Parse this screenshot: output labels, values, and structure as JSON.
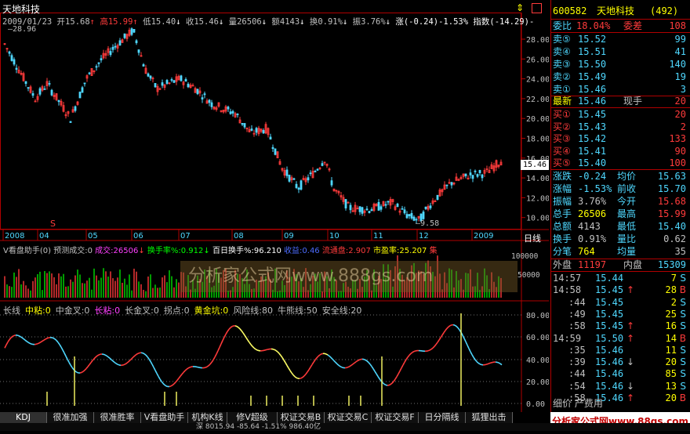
{
  "header": {
    "stock_name": "天地科技",
    "date": "2009/01/23",
    "open_label": "开",
    "open": "15.68",
    "high_label": "高",
    "high": "15.99",
    "low_label": "低",
    "low": "15.40",
    "close_label": "收",
    "close": "15.46",
    "volume_label": "量",
    "volume": "26506",
    "amount_label": "额",
    "amount": "4143",
    "turnover_label": "换",
    "turnover": "0.91%",
    "amplitude_label": "振",
    "amplitude": "3.76%",
    "change_label": "涨",
    "change": "(-0.24)-1.53%",
    "index_label": "指数",
    "index_change": "(-14.29)-",
    "high_marker": "28.96",
    "low_marker": "9.58",
    "price_tag": "15.46",
    "s_marker": "S"
  },
  "price_axis": [
    "28.00",
    "26.00",
    "24.00",
    "22.00",
    "20.00",
    "18.00",
    "16.00",
    "14.00",
    "12.00",
    "10.00"
  ],
  "month_axis": [
    "2008",
    "04",
    "05",
    "06",
    "07",
    "08",
    "09",
    "10",
    "11",
    "12",
    "2009"
  ],
  "period_label": "日线",
  "volume_panel": {
    "title": "V看盘助手(0)",
    "predict_label": "预测成交:0",
    "vol_label": "成交:26506",
    "turnover_label": "换手率%:0.912",
    "hundred_label": "百日换手%:96.210",
    "profit_label": "收益:0.46",
    "float_label": "流通盘:2.907",
    "pe_label": "市盈率:25.207",
    "tail_label": "集",
    "axis_top": "100000",
    "axis_mid": "50000",
    "watermark": "分析家公式网www.888gs.com"
  },
  "indicator_panel": {
    "items": [
      {
        "text": "长线",
        "color": "#c0c0c0"
      },
      {
        "text": "中粘:0",
        "color": "#ffff00"
      },
      {
        "text": "中金叉:0",
        "color": "#c0c0c0"
      },
      {
        "text": "长粘:0",
        "color": "#ff40ff"
      },
      {
        "text": "长金叉:0",
        "color": "#c0c0c0"
      },
      {
        "text": "拐点:0",
        "color": "#c0c0c0"
      },
      {
        "text": "黄金坑:0",
        "color": "#ffff00"
      },
      {
        "text": "风险线:80",
        "color": "#c0c0c0"
      },
      {
        "text": "牛熊线:50",
        "color": "#c0c0c0"
      },
      {
        "text": "安全线:20",
        "color": "#c0c0c0"
      }
    ],
    "axis": [
      "80.00",
      "60.00",
      "40.00",
      "20.00",
      "0.00"
    ]
  },
  "tabs": [
    "KDJ",
    "很准加强",
    "很准胜率",
    "V看盘助手",
    "机构K线",
    "修V超级MACD",
    "权证交易B",
    "权证交易C",
    "权证交易F",
    "日分隔线",
    "狐狸出击"
  ],
  "quote": {
    "code": "600582",
    "name": "天地科技",
    "count": "(492)",
    "weibi_label": "委比",
    "weibi": "18.04%",
    "weicha_label": "委差",
    "weicha": "108",
    "sells": [
      {
        "label": "卖⑤",
        "price": "15.52",
        "vol": "99"
      },
      {
        "label": "卖④",
        "price": "15.51",
        "vol": "41"
      },
      {
        "label": "卖③",
        "price": "15.50",
        "vol": "140"
      },
      {
        "label": "卖②",
        "price": "15.49",
        "vol": "19"
      },
      {
        "label": "卖①",
        "price": "15.46",
        "vol": "3"
      }
    ],
    "last_label": "最新",
    "last": "15.46",
    "now_label": "现手",
    "now_vol": "20",
    "buys": [
      {
        "label": "买①",
        "price": "15.45",
        "vol": "20"
      },
      {
        "label": "买②",
        "price": "15.43",
        "vol": "2"
      },
      {
        "label": "买③",
        "price": "15.42",
        "vol": "133"
      },
      {
        "label": "买④",
        "price": "15.41",
        "vol": "90"
      },
      {
        "label": "买⑤",
        "price": "15.40",
        "vol": "100"
      }
    ],
    "stats": [
      {
        "l1": "涨跌",
        "v1": "-0.24",
        "l2": "均价",
        "v2": "15.63"
      },
      {
        "l1": "涨幅",
        "v1": "-1.53%",
        "l2": "前收",
        "v2": "15.70"
      },
      {
        "l1": "振幅",
        "v1": "3.76%",
        "l2": "今开",
        "v2": "15.68"
      },
      {
        "l1": "总手",
        "v1": "26506",
        "l2": "最高",
        "v2": "15.99"
      },
      {
        "l1": "总额",
        "v1": "4143",
        "l2": "最低",
        "v2": "15.40"
      },
      {
        "l1": "换手",
        "v1": "0.91%",
        "l2": "量比",
        "v2": "0.62"
      },
      {
        "l1": "分笔",
        "v1": "764",
        "l2": "均量",
        "v2": "35"
      }
    ],
    "outer_label": "外盘",
    "outer": "11197",
    "inner_label": "内盘",
    "inner": "15309",
    "ticks": [
      {
        "time": "14:57",
        "price": "15.44",
        "arrow": "",
        "vol": "7",
        "side": "S"
      },
      {
        "time": "14:58",
        "price": "15.45",
        "arrow": "↑",
        "vol": "28",
        "side": "B"
      },
      {
        "time": ":44",
        "price": "15.45",
        "arrow": "",
        "vol": "2",
        "side": "S"
      },
      {
        "time": ":49",
        "price": "15.45",
        "arrow": "",
        "vol": "25",
        "side": "S"
      },
      {
        "time": ":58",
        "price": "15.45",
        "arrow": "↑",
        "vol": "16",
        "side": "S"
      },
      {
        "time": "14:59",
        "price": "15.50",
        "arrow": "↑",
        "vol": "14",
        "side": "B"
      },
      {
        "time": ":35",
        "price": "15.46",
        "arrow": "",
        "vol": "11",
        "side": "S"
      },
      {
        "time": ":39",
        "price": "15.46",
        "arrow": "↓",
        "vol": "20",
        "side": "S"
      },
      {
        "time": ":44",
        "price": "15.46",
        "arrow": "",
        "vol": "85",
        "side": "S"
      },
      {
        "time": ":54",
        "price": "15.46",
        "arrow": "↓",
        "vol": "13",
        "side": "S"
      },
      {
        "time": ":58",
        "price": "15.46",
        "arrow": "↑",
        "vol": "20",
        "side": "B"
      }
    ],
    "footer": "细价 产费用"
  },
  "logo": "分析家公式网www.88gs.com",
  "status": "深 8015.94 -85.64 -1.51% 986.40亿",
  "colors": {
    "up": "#ff3b3b",
    "down": "#4fd8ff",
    "grid": "#b00000",
    "background": "#000000"
  }
}
